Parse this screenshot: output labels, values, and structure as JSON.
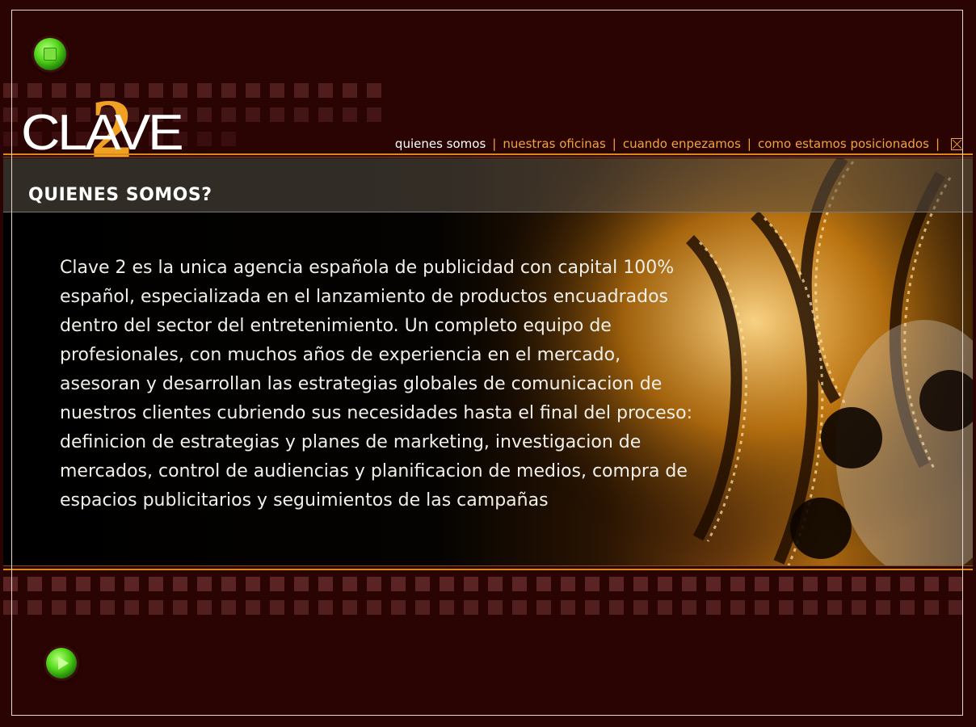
{
  "brand": {
    "logo_word": "CLAVE",
    "logo_number": "2"
  },
  "nav": {
    "items": [
      {
        "label": "quienes somos",
        "active": true
      },
      {
        "label": "nuestras oficinas",
        "active": false
      },
      {
        "label": "cuando enpezamos",
        "active": false
      },
      {
        "label": "como estamos posicionados",
        "active": false
      }
    ],
    "separator": "|",
    "close_icon": "close-box-icon"
  },
  "section": {
    "title": "QUIENES SOMOS?",
    "body": "Clave 2 es la unica agencia española de publicidad con capital 100% español, especializada en el lanzamiento de productos encuadrados dentro del sector del entretenimiento. Un completo equipo de profesionales, con muchos años de experiencia en el mercado, asesoran y desarrollan las estrategias globales de comunicacion de nuestros clientes cubriendo sus necesidades hasta el final del proceso: definicion de estrategias y planes de marketing, investigacion de mercados, control de audiencias y planificacion de medios, compra de espacios publicitarios y seguimientos de las campañas"
  },
  "controls": {
    "top_button_icon": "stop-icon",
    "bottom_button_icon": "play-icon"
  },
  "colors": {
    "background": "#2a0303",
    "accent": "#f3a43a",
    "logo_number": "#f0a022",
    "button_green": "#55d81c"
  }
}
